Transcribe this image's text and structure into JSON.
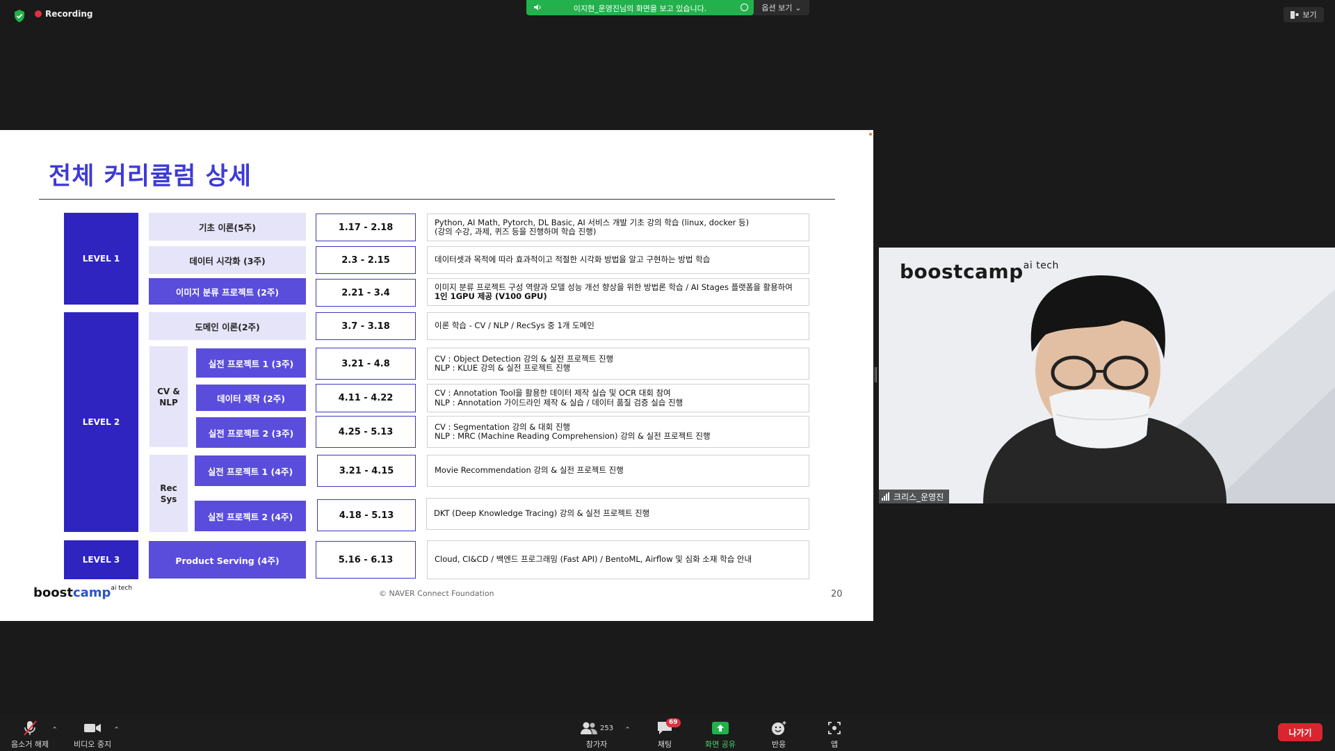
{
  "topbar": {
    "recording_label": "Recording",
    "share_banner_text": "이지현_운영진님의 화면을 보고 있습니다.",
    "view_options_label": "옵션 보기",
    "view_button_label": "보기"
  },
  "slide": {
    "title": "전체 커리큘럼 상세",
    "levels": {
      "level1": "LEVEL 1",
      "level2": "LEVEL 2",
      "level3": "LEVEL 3"
    },
    "groups": {
      "cv_nlp": "CV &\nNLP",
      "recsys": "Rec\nSys"
    },
    "rows": [
      {
        "topic": "기초 이론(5주)",
        "date": "1.17 - 2.18",
        "desc": [
          "Python, AI Math, Pytorch, DL Basic, AI 서비스 개발 기초 강의 학습 (linux, docker 등)",
          "(강의 수강, 과제, 퀴즈 등을 진행하며 학습 진행)"
        ]
      },
      {
        "topic": "데이터 시각화 (3주)",
        "date": "2.3 - 2.15",
        "desc": [
          "데이터셋과 목적에 따라 효과적이고 적절한 시각화 방법을 알고 구현하는 방법 학습"
        ]
      },
      {
        "topic": "이미지 분류 프로젝트 (2주)",
        "date": "2.21 - 3.4",
        "desc": [
          "이미지 분류 프로젝트 구성 역량과 모델 성능 개선 향상을 위한 방법론 학습 / AI Stages 플랫폼을 활용하여",
          "1인 1GPU 제공 (V100 GPU)"
        ]
      },
      {
        "topic": "도메인 이론(2주)",
        "date": "3.7 - 3.18",
        "desc": [
          "이론 학습 - CV / NLP / RecSys 중 1개 도메인"
        ]
      },
      {
        "topic": "실전 프로젝트 1 (3주)",
        "date": "3.21 - 4.8",
        "desc": [
          "CV : Object Detection 강의 & 실전 프로젝트 진행",
          "NLP : KLUE 강의 &  실전 프로젝트 진행"
        ]
      },
      {
        "topic": "데이터 제작 (2주)",
        "date": "4.11 - 4.22",
        "desc": [
          "CV : Annotation Tool을 활용한 데이터 제작 실습 및 OCR 대회 참여",
          "NLP : Annotation 가이드라인 제작 & 실습 / 데이터 품질 검증 실습 진행"
        ]
      },
      {
        "topic": "실전 프로젝트 2 (3주)",
        "date": "4.25 - 5.13",
        "desc": [
          "CV : Segmentation 강의 & 대회 진행",
          "NLP : MRC (Machine Reading Comprehension) 강의 &  실전 프로젝트 진행"
        ]
      },
      {
        "topic": "실전 프로젝트 1 (4주)",
        "date": "3.21 - 4.15",
        "desc": [
          "Movie Recommendation 강의 &  실전 프로젝트 진행"
        ]
      },
      {
        "topic": "실전 프로젝트 2 (4주)",
        "date": "4.18 - 5.13",
        "desc": [
          "DKT (Deep Knowledge Tracing) 강의 &  실전 프로젝트 진행"
        ]
      },
      {
        "topic": "Product Serving (4주)",
        "date": "5.16 - 6.13",
        "desc": [
          "Cloud, CI&CD / 백엔드 프로그래밍 (Fast API) / BentoML, Airflow 및 심화 소재 학습 안내"
        ]
      }
    ],
    "footer": {
      "logo_boost": "boost",
      "logo_camp": "camp",
      "logo_sup": "ai tech",
      "copyright": "©  NAVER Connect Foundation",
      "page_number": "20"
    }
  },
  "webcam": {
    "logo": "boostcamp",
    "logo_sup": "ai tech",
    "participant_name": "크리스_운영진"
  },
  "toolbar": {
    "unmute_label": "음소거 해제",
    "stop_video_label": "비디오 중지",
    "participants_label": "참가자",
    "participants_count": "253",
    "chat_label": "채팅",
    "chat_badge": "69",
    "share_screen_label": "화면 공유",
    "reactions_label": "반응",
    "apps_label": "앱",
    "leave_label": "나가기"
  }
}
